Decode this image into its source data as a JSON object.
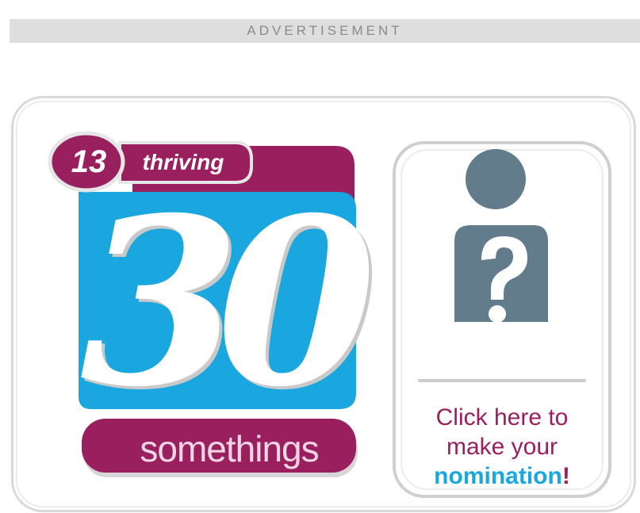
{
  "advertisement": {
    "label": "ADVERTISEMENT"
  },
  "ad": {
    "logo": {
      "badge_number": "13",
      "badge_word": "thriving",
      "big_number": "30",
      "sub_word": "somethings"
    },
    "cta": {
      "line1": "Click here to",
      "line2": "make your",
      "highlight": "nomination",
      "bang": "!"
    },
    "icons": {
      "mystery_person": "mystery-person-icon"
    }
  },
  "colors": {
    "magenta": "#9a1f5f",
    "cyan": "#1aa6de",
    "slate": "#627c8c",
    "ad_bar": "#dedede"
  }
}
